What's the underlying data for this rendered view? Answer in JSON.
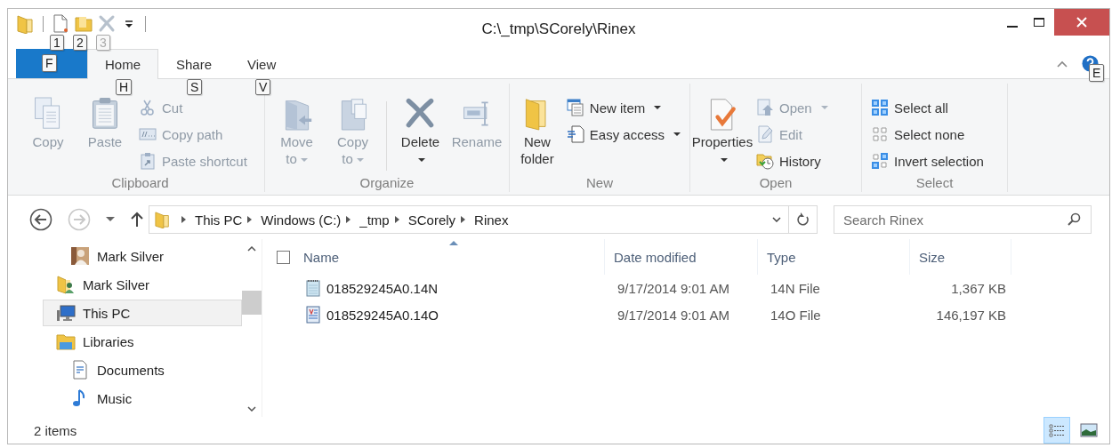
{
  "window": {
    "title": "C:\\_tmp\\SCorely\\Rinex"
  },
  "quick_access": [
    {
      "keytip": "1",
      "disabled": false
    },
    {
      "keytip": "2",
      "disabled": false
    },
    {
      "keytip": "3",
      "disabled": true
    }
  ],
  "file_tab": {
    "keytip": "F"
  },
  "tabs": [
    {
      "label": "Home",
      "keytip": "H",
      "selected": true
    },
    {
      "label": "Share",
      "keytip": "S",
      "selected": false
    },
    {
      "label": "View",
      "keytip": "V",
      "selected": false
    }
  ],
  "help": {
    "keytip": "E"
  },
  "ribbon_groups": [
    {
      "label": "Clipboard",
      "commands": [
        {
          "kind": "large",
          "label": "Copy",
          "disabled": true,
          "dropdown": false
        },
        {
          "kind": "large",
          "label": "Paste",
          "disabled": true,
          "dropdown": false
        },
        {
          "kind": "small",
          "label": "Cut",
          "disabled": true,
          "dropdown": false
        },
        {
          "kind": "small",
          "label": "Copy path",
          "disabled": true,
          "dropdown": false
        },
        {
          "kind": "small",
          "label": "Paste shortcut",
          "disabled": true,
          "dropdown": false
        }
      ]
    },
    {
      "label": "Organize",
      "commands": [
        {
          "kind": "large",
          "label": "Move to",
          "disabled": true,
          "dropdown": true
        },
        {
          "kind": "large",
          "label": "Copy to",
          "disabled": true,
          "dropdown": true
        },
        {
          "kind": "separator"
        },
        {
          "kind": "large",
          "label": "Delete",
          "disabled": false,
          "dropdown": true
        },
        {
          "kind": "large",
          "label": "Rename",
          "disabled": true,
          "dropdown": false
        }
      ]
    },
    {
      "label": "New",
      "commands": [
        {
          "kind": "large",
          "label": "New folder",
          "disabled": false,
          "dropdown": false
        },
        {
          "kind": "small",
          "label": "New item",
          "disabled": false,
          "dropdown": true
        },
        {
          "kind": "small",
          "label": "Easy access",
          "disabled": false,
          "dropdown": true
        }
      ]
    },
    {
      "label": "Open",
      "commands": [
        {
          "kind": "large",
          "label": "Properties",
          "disabled": false,
          "dropdown": true
        },
        {
          "kind": "small",
          "label": "Open",
          "disabled": true,
          "dropdown": true
        },
        {
          "kind": "small",
          "label": "Edit",
          "disabled": true,
          "dropdown": false
        },
        {
          "kind": "small",
          "label": "History",
          "disabled": false,
          "dropdown": false
        }
      ]
    },
    {
      "label": "Select",
      "commands": [
        {
          "kind": "small",
          "label": "Select all",
          "disabled": false,
          "dropdown": false
        },
        {
          "kind": "small",
          "label": "Select none",
          "disabled": false,
          "dropdown": false
        },
        {
          "kind": "small",
          "label": "Invert selection",
          "disabled": false,
          "dropdown": false
        }
      ]
    }
  ],
  "navigation": {
    "back_disabled": false,
    "forward_disabled": true
  },
  "breadcrumbs": [
    "This PC",
    "Windows (C:)",
    "_tmp",
    "SCorely",
    "Rinex"
  ],
  "search": {
    "placeholder": "Search Rinex"
  },
  "nav_pane": {
    "items": [
      {
        "children": [
          {
            "label": "Mark Silver",
            "kind": "person",
            "selected": false
          }
        ]
      },
      {
        "label": "Mark Silver",
        "kind": "user-folder",
        "selected": false
      },
      {
        "label": "This PC",
        "kind": "computer",
        "selected": true
      },
      {
        "label": "Libraries",
        "kind": "library",
        "selected": false,
        "children": [
          {
            "label": "Documents",
            "kind": "documents",
            "selected": false
          },
          {
            "label": "Music",
            "kind": "music",
            "selected": false
          }
        ]
      }
    ]
  },
  "file_list": {
    "select_all_checked": false,
    "columns": [
      {
        "label": "Name",
        "sorted": true
      },
      {
        "label": "Date modified",
        "sorted": false
      },
      {
        "label": "Type",
        "sorted": false
      },
      {
        "label": "Size",
        "sorted": false
      }
    ],
    "rows": [
      {
        "kind": "text",
        "name": "018529245A0.14N",
        "date": "9/17/2014 9:01 AM",
        "type": "14N File",
        "size": "1,367 KB"
      },
      {
        "kind": "document",
        "name": "018529245A0.14O",
        "date": "9/17/2014 9:01 AM",
        "type": "14O File",
        "size": "146,197 KB"
      }
    ]
  },
  "status_bar": {
    "text": "2 items"
  },
  "views": [
    {
      "selected": true
    },
    {
      "selected": false
    }
  ]
}
